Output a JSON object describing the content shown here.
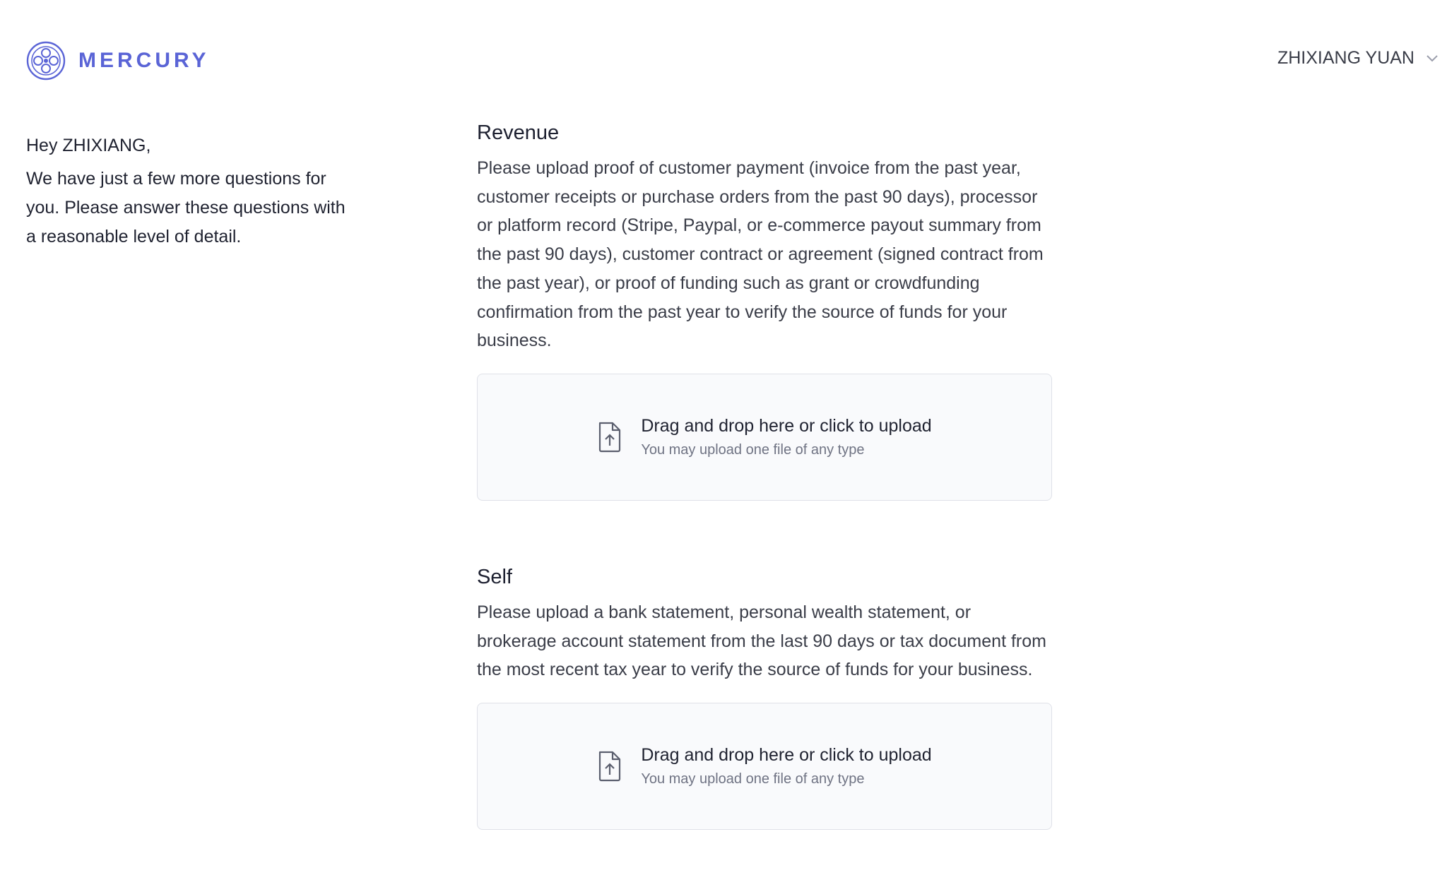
{
  "header": {
    "brand": "MERCURY",
    "user_name": "ZHIXIANG YUAN",
    "brand_color": "#5a64d6"
  },
  "sidebar": {
    "greeting": "Hey ZHIXIANG,",
    "message": "We have just a few more questions for you. Please answer these questions with a reasonable level of detail."
  },
  "sections": [
    {
      "title": "Revenue",
      "description": "Please upload proof of customer payment (invoice from the past year, customer receipts or purchase orders from the past 90 days), processor or platform record (Stripe, Paypal, or e-commerce payout summary from the past 90 days), customer contract or agreement (signed contract from the past year), or proof of funding such as grant or crowdfunding confirmation from the past year to verify the source of funds for your business.",
      "upload_title": "Drag and drop here or click to upload",
      "upload_hint": "You may upload one file of any type",
      "icon": "file-upload-icon"
    },
    {
      "title": "Self",
      "description": "Please upload a bank statement, personal wealth statement, or brokerage account statement from the last 90 days or tax document from the most recent tax year to verify the source of funds for your business.",
      "upload_title": "Drag and drop here or click to upload",
      "upload_hint": "You may upload one file of any type",
      "icon": "file-upload-icon"
    }
  ]
}
